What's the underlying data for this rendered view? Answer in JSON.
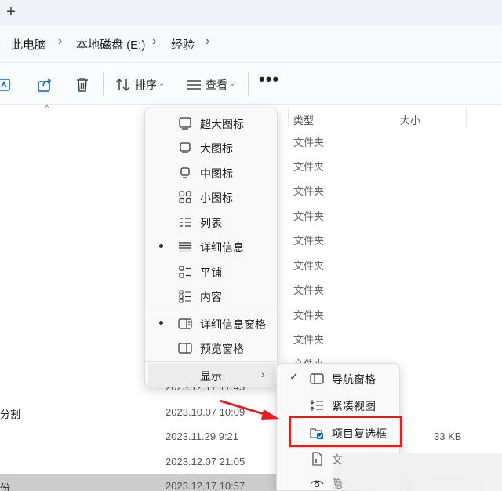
{
  "window": {
    "tab_add": "+"
  },
  "breadcrumb": [
    "此电脑",
    "本地磁盘 (E:)",
    "经验"
  ],
  "toolbar": {
    "sort_label": "排序",
    "view_label": "查看",
    "more": "•••"
  },
  "columns": {
    "type": "类型",
    "size": "大小"
  },
  "rows": [
    {
      "type": "文件夹"
    },
    {
      "type": "文件夹"
    },
    {
      "type": "文件夹"
    },
    {
      "type": "文件夹"
    },
    {
      "type": "文件夹"
    },
    {
      "type": "文件夹"
    },
    {
      "type": "文件夹"
    },
    {
      "type": "文件夹"
    },
    {
      "type": "文件夹"
    },
    {
      "type": "文件夹"
    }
  ],
  "file_rows": [
    {
      "name": "",
      "date": "2023.12.17 17:45",
      "size": ""
    },
    {
      "name": "分割",
      "date": "2023.10.07 10:09",
      "size": ""
    },
    {
      "name": "",
      "date": "2023.11.29 9:21",
      "size": "33 KB"
    },
    {
      "name": "",
      "date": "2023.12.07 21:05",
      "size": ""
    },
    {
      "name": "份",
      "date": "2023.12.17 10:57",
      "size": ""
    }
  ],
  "view_menu": {
    "items": [
      {
        "label": "超大图标",
        "icon": "extra-large-icons-icon",
        "selected": false
      },
      {
        "label": "大图标",
        "icon": "large-icons-icon",
        "selected": false
      },
      {
        "label": "中图标",
        "icon": "medium-icons-icon",
        "selected": false
      },
      {
        "label": "小图标",
        "icon": "small-icons-icon",
        "selected": false
      },
      {
        "label": "列表",
        "icon": "list-icon",
        "selected": false
      },
      {
        "label": "详细信息",
        "icon": "details-icon",
        "selected": true
      },
      {
        "label": "平铺",
        "icon": "tiles-icon",
        "selected": false
      },
      {
        "label": "内容",
        "icon": "content-icon",
        "selected": false
      }
    ],
    "panes": [
      {
        "label": "详细信息窗格",
        "icon": "details-pane-icon",
        "selected": true
      },
      {
        "label": "预览窗格",
        "icon": "preview-pane-icon",
        "selected": false
      }
    ],
    "show_label": "显示"
  },
  "show_submenu": {
    "items": [
      {
        "label": "导航窗格",
        "icon": "navigation-pane-icon",
        "checked": true
      },
      {
        "label": "紧凑视图",
        "icon": "compact-view-icon",
        "checked": false
      },
      {
        "label": "项目复选框",
        "icon": "item-checkbox-icon",
        "checked": false
      },
      {
        "label": "文",
        "icon": "file-extension-icon",
        "checked": false
      },
      {
        "label": "隐",
        "icon": "hidden-items-icon",
        "checked": false
      }
    ]
  },
  "colors": {
    "highlight": "#e02020",
    "accent": "#0067c0"
  }
}
